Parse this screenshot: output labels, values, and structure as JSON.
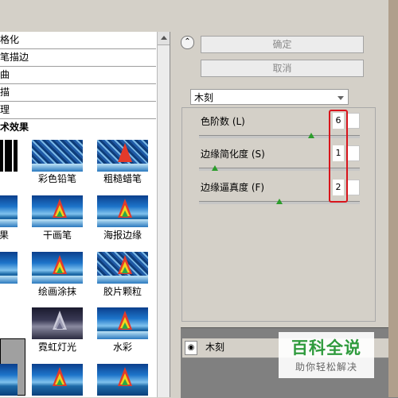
{
  "filter_list": {
    "categories": [
      {
        "label": "格化"
      },
      {
        "label": "笔描边"
      },
      {
        "label": "曲"
      },
      {
        "label": "描"
      },
      {
        "label": "理"
      },
      {
        "label": "术效果"
      }
    ],
    "thumbnails": [
      {
        "label": ""
      },
      {
        "label": "彩色铅笔"
      },
      {
        "label": "粗糙蜡笔"
      },
      {
        "label": "果"
      },
      {
        "label": "干画笔"
      },
      {
        "label": "海报边缘"
      },
      {
        "label": ""
      },
      {
        "label": "绘画涂抹"
      },
      {
        "label": "胶片颗粒"
      },
      {
        "label": ""
      },
      {
        "label": "霓虹灯光"
      },
      {
        "label": "水彩"
      }
    ]
  },
  "buttons": {
    "collapse_icon": "chevron-up-icon",
    "ok_label": "确定",
    "cancel_label": "取消"
  },
  "filter_select": {
    "value": "木刻"
  },
  "params": [
    {
      "label": "色阶数 (L)",
      "value": "6",
      "slider_fraction": 0.7
    },
    {
      "label": "边缘简化度 (S)",
      "value": "1",
      "slider_fraction": 0.1
    },
    {
      "label": "边缘逼真度 (F)",
      "value": "2",
      "slider_fraction": 0.5
    }
  ],
  "layers": {
    "eye_icon": "eye-icon",
    "name": "木刻"
  },
  "watermark": {
    "title": "百科全说",
    "subtitle": "助你轻松解决"
  },
  "colors": {
    "highlight": "#d8141b",
    "slider_knob": "#2b9c2b",
    "watermark_green": "#2f9b3d"
  }
}
